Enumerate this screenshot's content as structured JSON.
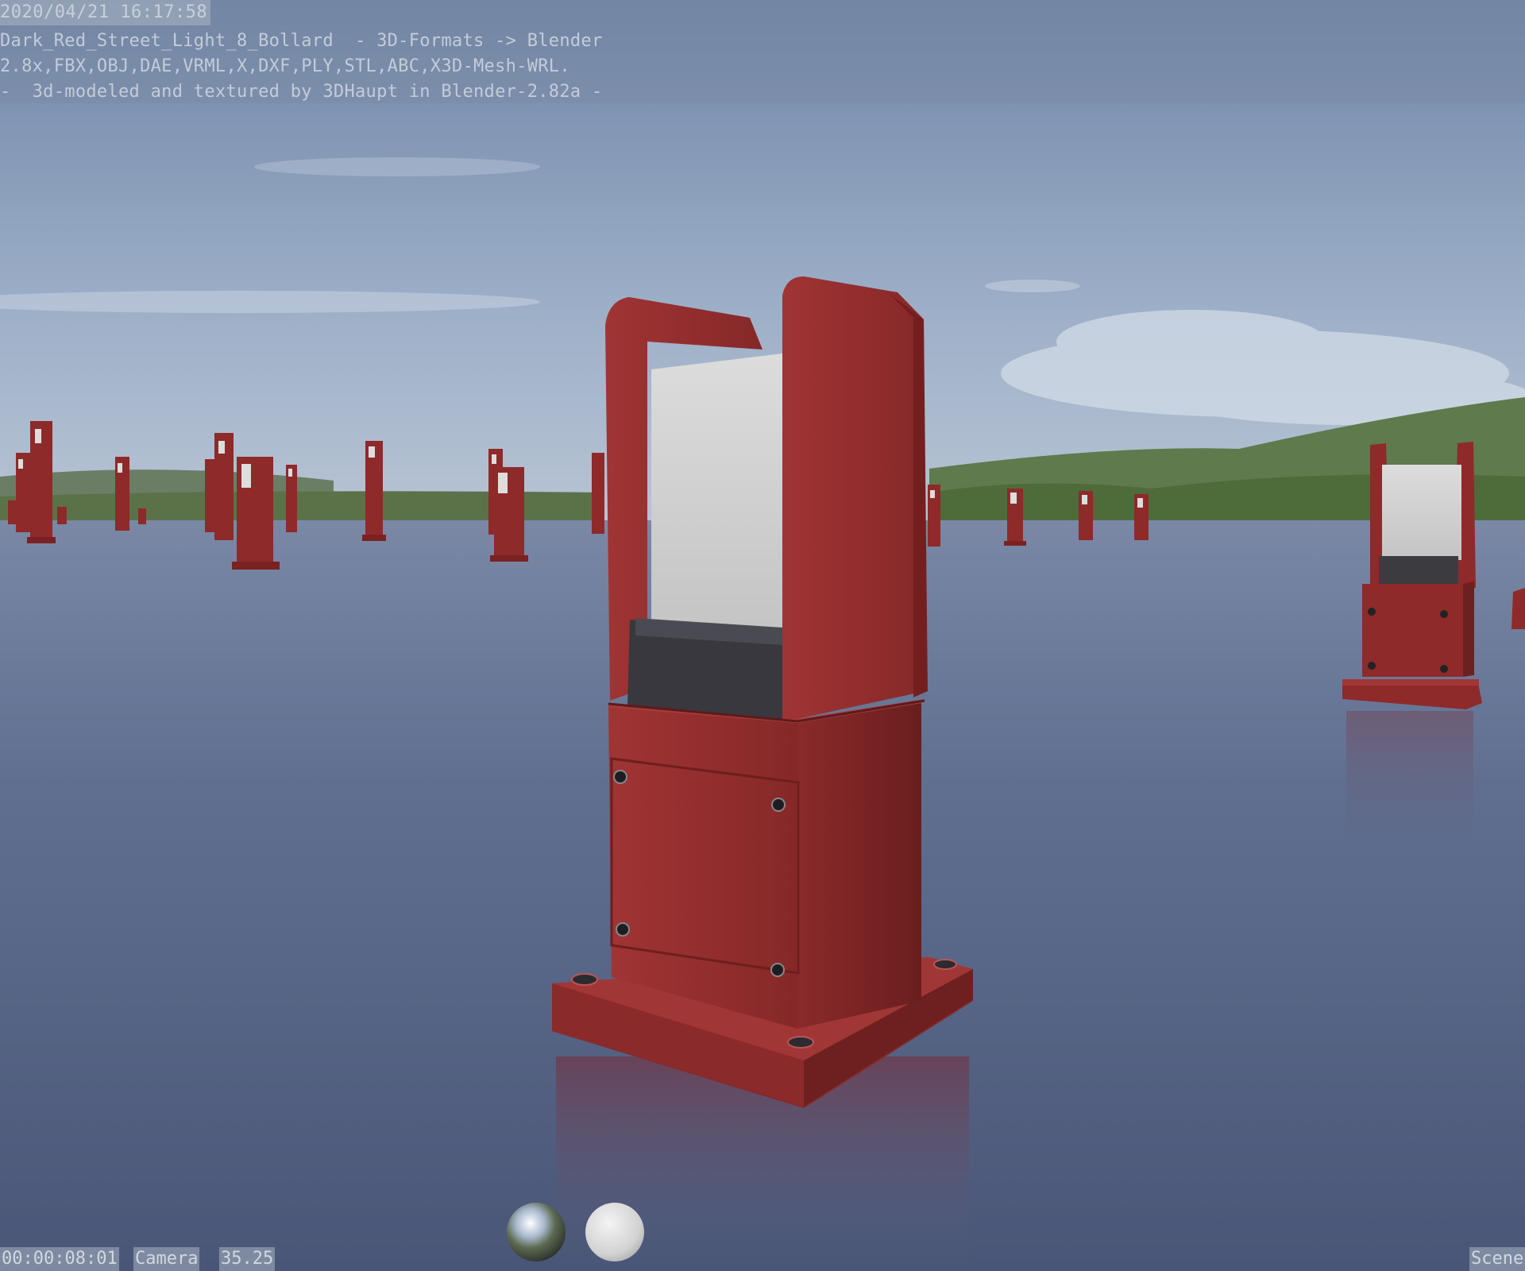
{
  "stamp": {
    "date": "2020/04/21 16:17:58",
    "line1": "Dark_Red_Street_Light_8_Bollard  - 3D-Formats -> Blender",
    "line2": "2.8x,FBX,OBJ,DAE,VRML,X,DXF,PLY,STL,ABC,X3D-Mesh-WRL.",
    "line3": "-  3d-modeled and textured by 3DHaupt in Blender-2.82a -"
  },
  "status": {
    "time": "00:00:08:01",
    "camera": "Camera",
    "lens": "35.25",
    "scene": "Scene"
  },
  "lookdev": {
    "hdri_ball": "hdri-preview-sphere",
    "diffuse_ball": "diffuse-preview-sphere"
  },
  "colors": {
    "bollard_red": "#8e2a2a",
    "lamp_white": "#d8d8d8",
    "sky_top": "#7a8fb0",
    "floor": "#5b6a8a"
  }
}
